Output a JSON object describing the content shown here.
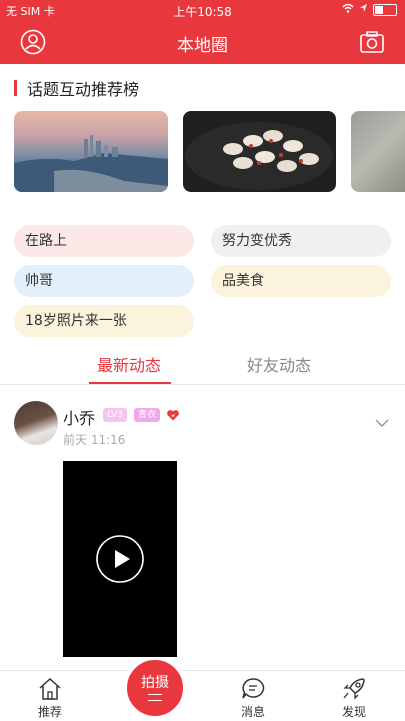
{
  "status_bar": {
    "carrier": "无 SIM 卡",
    "time": "上午10:58"
  },
  "nav": {
    "title": "本地圈"
  },
  "section": {
    "title": "话题互动推荐榜"
  },
  "tags": [
    "在路上",
    "努力变优秀",
    "帅哥",
    "品美食",
    "18岁照片来一张"
  ],
  "tabs": {
    "latest": "最新动态",
    "friends": "好友动态"
  },
  "post": {
    "username": "小乔",
    "level": "LV3",
    "badge": "青衣",
    "time": "前天 11:16"
  },
  "tabbar": {
    "recommend": "推荐",
    "shoot": "拍摄",
    "messages": "消息",
    "discover": "发现"
  },
  "colors": {
    "accent": "#e8383d"
  }
}
